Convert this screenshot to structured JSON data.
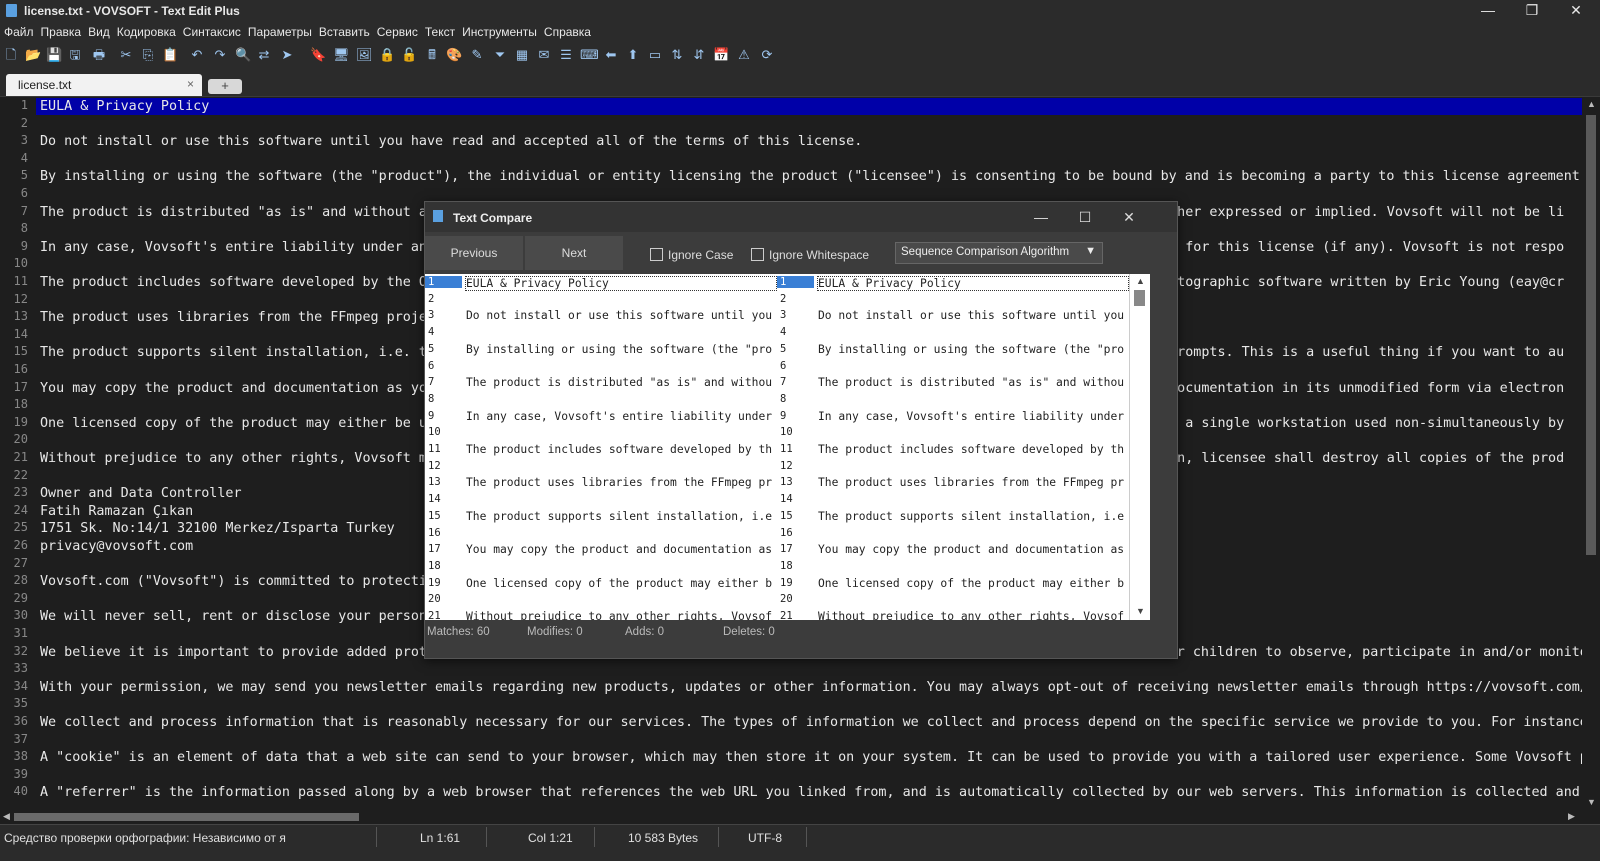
{
  "window": {
    "title": "license.txt - VOVSOFT - Text Edit Plus",
    "minimize": "—",
    "restore": "❐",
    "close": "✕"
  },
  "menu": [
    "Файл",
    "Правка",
    "Вид",
    "Кодировка",
    "Синтаксис",
    "Параметры",
    "Вставить",
    "Сервис",
    "Текст",
    "Инструменты",
    "Справка"
  ],
  "toolbar_icons": [
    "new-file-icon",
    "open-folder-icon",
    "save-icon",
    "save-all-icon",
    "print-icon",
    "cut-icon",
    "copy-icon",
    "paste-icon",
    "undo-icon",
    "redo-icon",
    "find-icon",
    "replace-icon",
    "goto-icon",
    "bookmark-icon",
    "monitor-icon",
    "image-icon",
    "lock-icon",
    "unlock-icon",
    "calculator-icon",
    "color-picker-icon",
    "eyedropper-icon",
    "filter-icon",
    "table-icon",
    "mail-icon",
    "list-icon",
    "keyboard-icon",
    "back-arrow-icon",
    "upload-icon",
    "panel-icon",
    "sort-icon",
    "sort-alt-icon",
    "calendar-icon",
    "warning-icon",
    "update-icon"
  ],
  "tab": {
    "label": "license.txt",
    "close": "×",
    "new": "+"
  },
  "editor": {
    "lines": [
      "EULA & Privacy Policy",
      "",
      "Do not install or use this software until you have read and accepted all of the terms of this license.",
      "",
      "By installing or using the software (the \"product\"), the individual or entity licensing the product (\"licensee\") is consenting to be bound by and is becoming a party to this license agreement (",
      "",
      "The product is distributed \"as is\" and without a",
      "",
      "In any case, Vovsoft's entire liability under an",
      "",
      "The product includes software developed by the O",
      "",
      "The product uses libraries from the FFmpeg proje",
      "",
      "The product supports silent installation, i.e. t",
      "",
      "You may copy the product and documentation as yo",
      "",
      "One licensed copy of the product may either be u",
      "",
      "Without prejudice to any other rights, Vovsoft m",
      "",
      "Owner and Data Controller",
      "Fatih Ramazan Çıkan",
      "1751 Sk. No:14/1 32100 Merkez/Isparta Turkey",
      "privacy@vovsoft.com",
      "",
      "Vovsoft.com (\"Vovsoft\") is committed to protecti",
      "",
      "We will never sell, rent or disclose your person",
      "",
      "We believe it is important to provide added protection for children online. We encourage parents and guardians to spend time online with their children to observe, participate in and/or monitor",
      "",
      "With your permission, we may send you newsletter emails regarding new products, updates or other information. You may always opt-out of receiving newsletter emails through https://vovsoft.com/n",
      "",
      "We collect and process information that is reasonably necessary for our services. The types of information we collect and process depend on the specific service we provide to you. For instance,",
      "",
      "A \"cookie\" is an element of data that a web site can send to your browser, which may then store it on your system. It can be used to provide you with a tailored user experience. Some Vovsoft pa",
      "",
      "A \"referrer\" is the information passed along by a web browser that references the web URL you linked from, and is automatically collected by our web servers. This information is collected and u"
    ],
    "right_fragments": [
      {
        "line": 7,
        "text": "either expressed or implied. Vovsoft will not be li"
      },
      {
        "line": 9,
        "text": "aid for this license (if any). Vovsoft is not respo"
      },
      {
        "line": 11,
        "text": "ryptographic software written by Eric Young (eay@cr"
      },
      {
        "line": 15,
        "text": "g prompts. This is a useful thing if you want to au"
      },
      {
        "line": 17,
        "text": "d documentation in its unmodified form via electron"
      },
      {
        "line": 19,
        "text": " on a single workstation used non-simultaneously by"
      },
      {
        "line": 21,
        "text": "tion, licensee shall destroy all copies of the prod"
      }
    ]
  },
  "status": {
    "spell": "Средство проверки орфографии: Независимо от я",
    "pos": "Ln 1:61",
    "col": "Col 1:21",
    "size": "10 583 Bytes",
    "encoding": "UTF-8"
  },
  "dialog": {
    "title": "Text Compare",
    "previous": "Previous",
    "next": "Next",
    "ignore_case": "Ignore Case",
    "ignore_whitespace": "Ignore Whitespace",
    "algorithm": "Sequence Comparison Algorithm",
    "lines": [
      "EULA & Privacy Policy",
      "",
      "Do not install or use this software until you",
      "",
      "By installing or using the software (the \"pro",
      "",
      "The product is distributed \"as is\" and withou",
      "",
      "In any case, Vovsoft's entire liability under",
      "",
      "The product includes software developed by th",
      "",
      "The product uses libraries from the FFmpeg pr",
      "",
      "The product supports silent installation, i.e",
      "",
      "You may copy the product and documentation as",
      "",
      "One licensed copy of the product may either b",
      "",
      "Without prejudice to any other rights, Vovsof"
    ],
    "matches": "Matches: 60",
    "modifies": "Modifies: 0",
    "adds": "Adds: 0",
    "deletes": "Deletes: 0"
  }
}
